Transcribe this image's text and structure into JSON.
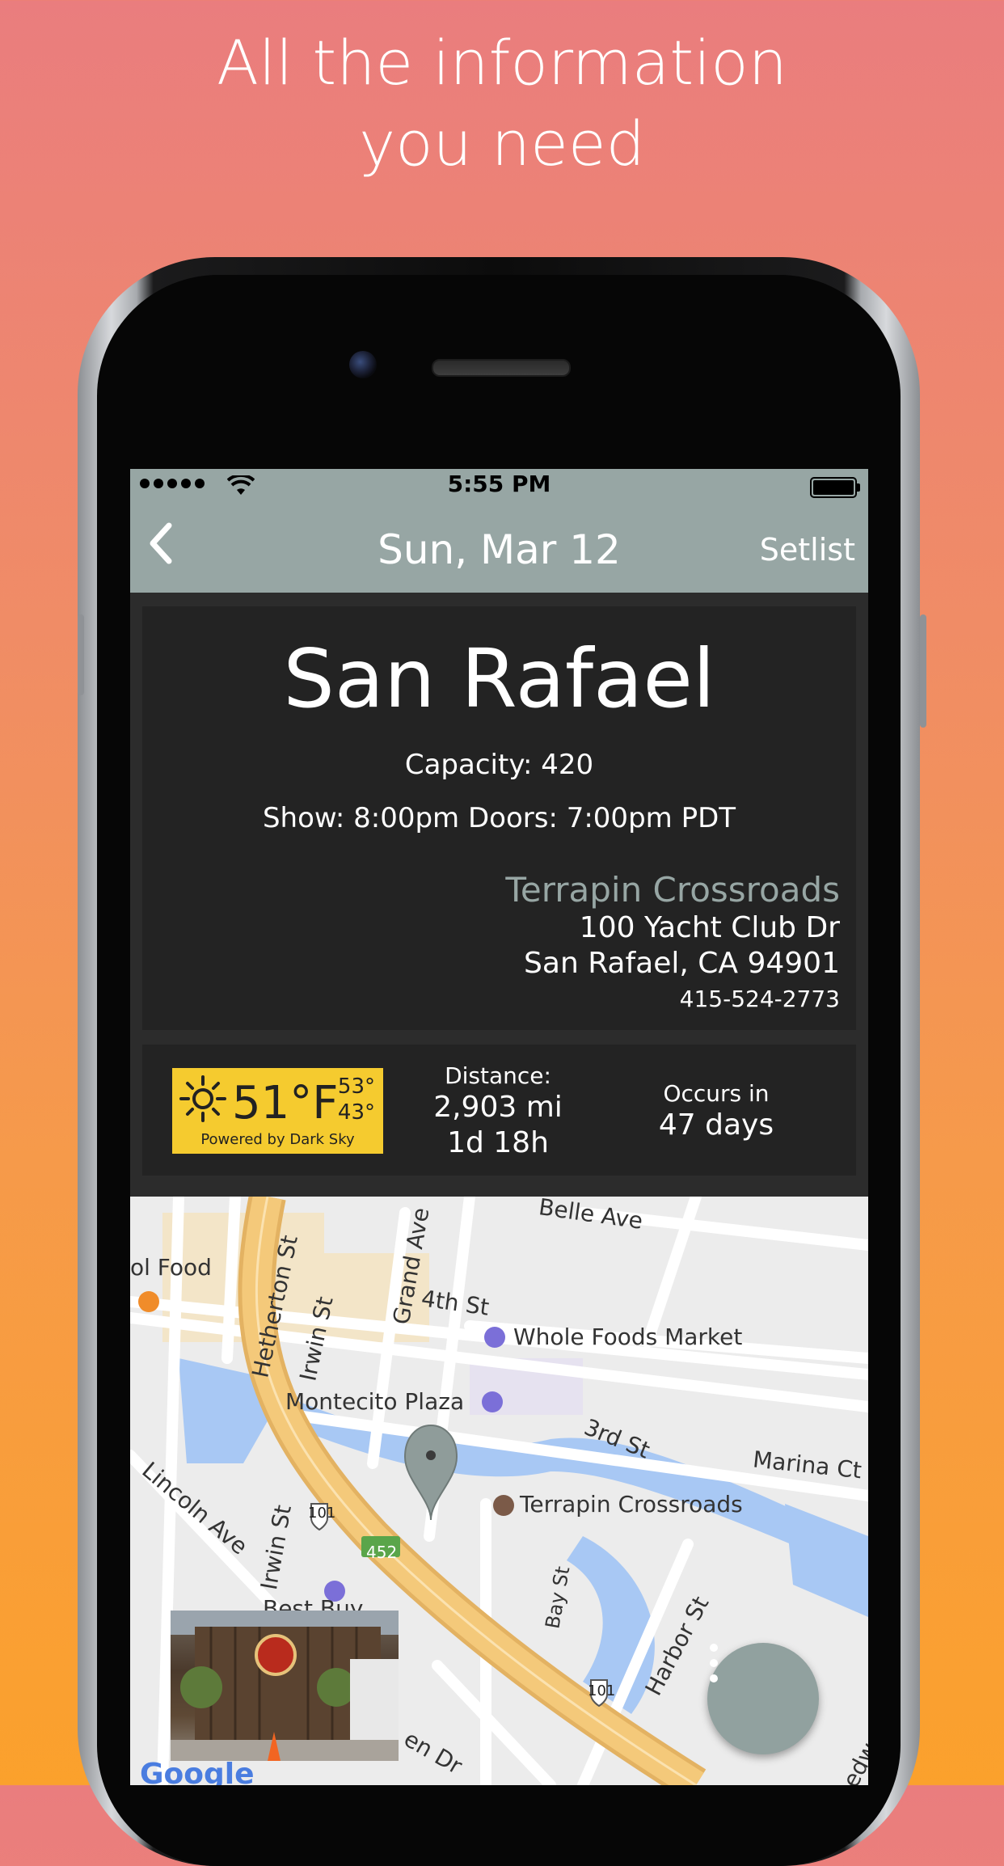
{
  "headline": {
    "line1": "All the information",
    "line2": "you need"
  },
  "status_bar": {
    "time": "5:55 PM",
    "wifi_icon": "wifi-icon"
  },
  "nav": {
    "back_icon": "chevron-left-icon",
    "title": "Sun, Mar 12",
    "setlist_label": "Setlist"
  },
  "venue": {
    "city": "San Rafael",
    "capacity": "Capacity: 420",
    "showtimes": "Show: 8:00pm Doors: 7:00pm PDT",
    "name": "Terrapin Crossroads",
    "address_line1": "100 Yacht Club Dr",
    "address_line2": "San Rafael, CA 94901",
    "phone": "415-524-2773"
  },
  "info": {
    "weather": {
      "icon": "sun-icon",
      "temp": "51°F",
      "high": "53°",
      "low": "43°",
      "powered_by": "Powered by Dark Sky"
    },
    "distance": {
      "label": "Distance:",
      "miles": "2,903 mi",
      "duration": "1d  18h"
    },
    "occurs": {
      "label": "Occurs in",
      "days": "47 days"
    }
  },
  "map": {
    "labels": {
      "belle_ave": "Belle Ave",
      "ol_food": "ol Food",
      "hetherton_st": "Hetherton St",
      "grand_ave": "Grand Ave",
      "fourth_st": "4th St",
      "irwin_st": "Irwin St",
      "whole_foods": "Whole Foods Market",
      "montecito_plaza": "Montecito Plaza",
      "third_st": "3rd St",
      "marina_ct": "Marina Ct D",
      "lincoln_ave": "Lincoln Ave",
      "irwin_st2": "Irwin St",
      "shield_101": "101",
      "shield_452": "452",
      "terrapin": "Terrapin Crossroads",
      "best_buy": "Best Buy",
      "bay_st": "Bay St",
      "harbor_st": "Harbor St",
      "shield_101b": "101",
      "en_dr": "en Dr",
      "edway": "edway B",
      "google": "Google"
    },
    "menu_icon": "more-vertical-icon"
  },
  "colors": {
    "accent": "#97a6a4",
    "card": "#232323",
    "weather_bg": "#f5cb2f",
    "highway": "#f4c97a",
    "water": "#a8c8f4"
  }
}
